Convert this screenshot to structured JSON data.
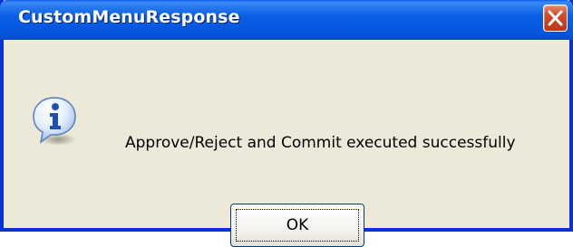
{
  "window": {
    "title": "CustomMenuResponse",
    "colors": {
      "titlebar": "#0a5fe4",
      "border": "#0831d9",
      "body": "#ece9d8",
      "close": "#c7401c"
    }
  },
  "titlebar": {
    "close_icon": "close-icon"
  },
  "dialog": {
    "icon": "info-icon",
    "message": "Approve/Reject and Commit executed successfully"
  },
  "buttons": {
    "ok_label": "OK"
  }
}
